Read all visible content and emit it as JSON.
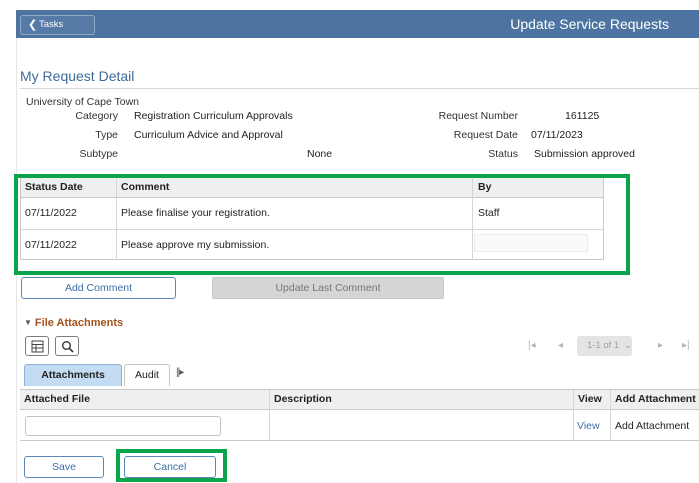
{
  "header": {
    "back_label": "Tasks",
    "page_title": "Update Service Requests"
  },
  "detail": {
    "section_title": "My Request Detail",
    "institution": "University of Cape Town",
    "category_label": "Category",
    "category_value": "Registration Curriculum Approvals",
    "type_label": "Type",
    "type_value": "Curriculum Advice and Approval",
    "subtype_label": "Subtype",
    "subtype_value": "None",
    "request_number_label": "Request Number",
    "request_number_value": "161125",
    "request_date_label": "Request Date",
    "request_date_value": "07/11/2023",
    "status_label": "Status",
    "status_value": "Submission approved"
  },
  "status_table": {
    "columns": [
      "Status Date",
      "Comment",
      "By"
    ],
    "rows": [
      {
        "date": "07/11/2022",
        "comment": "Please finalise your registration.",
        "by": "Staff"
      },
      {
        "date": "07/11/2022",
        "comment": "Please approve my submission.",
        "by": ""
      }
    ]
  },
  "actions": {
    "add_comment": "Add Comment",
    "update_last_comment": "Update Last Comment"
  },
  "attachments": {
    "section_title": "File Attachments",
    "pager": "1-1 of 1",
    "tabs": [
      "Attachments",
      "Audit"
    ],
    "columns": [
      "Attached File",
      "Description",
      "View",
      "Add Attachment"
    ],
    "row": {
      "view": "View",
      "add": "Add Attachment"
    }
  },
  "footer": {
    "save": "Save",
    "cancel": "Cancel"
  },
  "colors": {
    "header_bg": "#4d74a0",
    "highlight": "#0aa54a",
    "link": "#3c6ea8",
    "section_accent": "#a6521b"
  }
}
